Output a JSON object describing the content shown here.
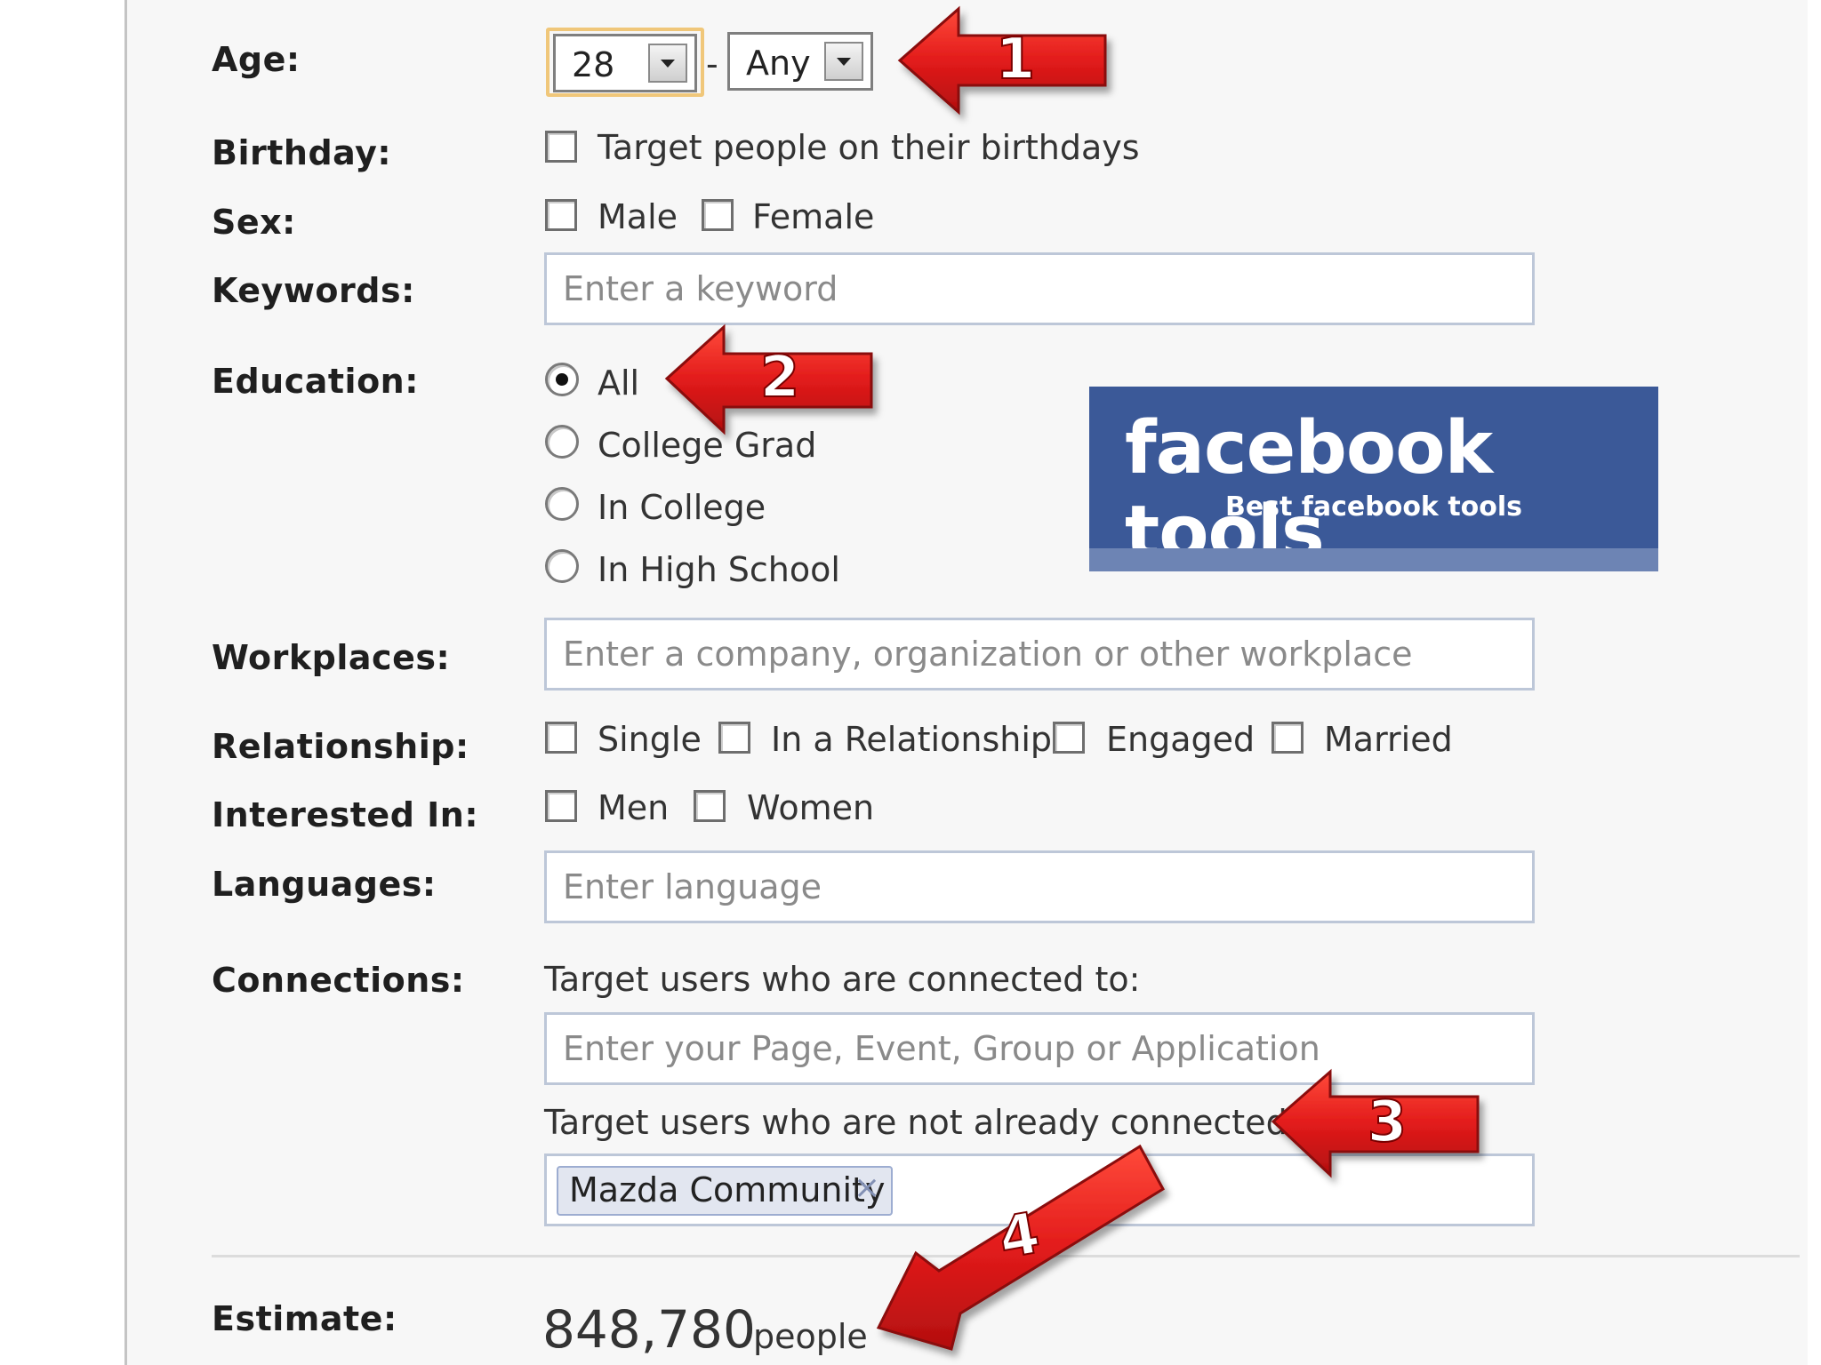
{
  "form": {
    "age": {
      "label": "Age:",
      "min": "28",
      "separator": "-",
      "max": "Any"
    },
    "birthday": {
      "label": "Birthday:",
      "option": "Target people on their birthdays",
      "checked": false
    },
    "sex": {
      "label": "Sex:",
      "options": [
        {
          "label": "Male",
          "checked": false
        },
        {
          "label": "Female",
          "checked": false
        }
      ]
    },
    "keywords": {
      "label": "Keywords:",
      "placeholder": "Enter a keyword",
      "value": ""
    },
    "education": {
      "label": "Education:",
      "options": [
        {
          "label": "All",
          "selected": true
        },
        {
          "label": "College Grad",
          "selected": false
        },
        {
          "label": "In College",
          "selected": false
        },
        {
          "label": "In High School",
          "selected": false
        }
      ]
    },
    "workplaces": {
      "label": "Workplaces:",
      "placeholder": "Enter a company, organization or other workplace",
      "value": ""
    },
    "relationship": {
      "label": "Relationship:",
      "options": [
        {
          "label": "Single",
          "checked": false
        },
        {
          "label": "In a Relationship",
          "checked": false
        },
        {
          "label": "Engaged",
          "checked": false
        },
        {
          "label": "Married",
          "checked": false
        }
      ]
    },
    "interested_in": {
      "label": "Interested In:",
      "options": [
        {
          "label": "Men",
          "checked": false
        },
        {
          "label": "Women",
          "checked": false
        }
      ]
    },
    "languages": {
      "label": "Languages:",
      "placeholder": "Enter language",
      "value": ""
    },
    "connections": {
      "label": "Connections:",
      "connected_prompt": "Target users who are connected to:",
      "connected_placeholder": "Enter your Page, Event, Group or Application",
      "not_connected_prompt": "Target users who are not already connected to:",
      "not_connected_tokens": [
        {
          "label": "Mazda Community",
          "remove": "×"
        }
      ]
    },
    "estimate": {
      "label": "Estimate:",
      "value": "848,780",
      "unit": "people"
    }
  },
  "banner": {
    "title": "facebook tools",
    "subtitle": "Best facebook tools"
  },
  "annotations": {
    "arrow_color": "#e21b1b",
    "callouts": [
      "1",
      "2",
      "3",
      "4"
    ]
  },
  "colors": {
    "panel_bg": "#f7f7f7",
    "input_border": "#bdc7d8",
    "facebook_blue": "#3b5998",
    "facebook_blue_light": "#6d84b4",
    "token_bg": "#e2e6f0"
  }
}
